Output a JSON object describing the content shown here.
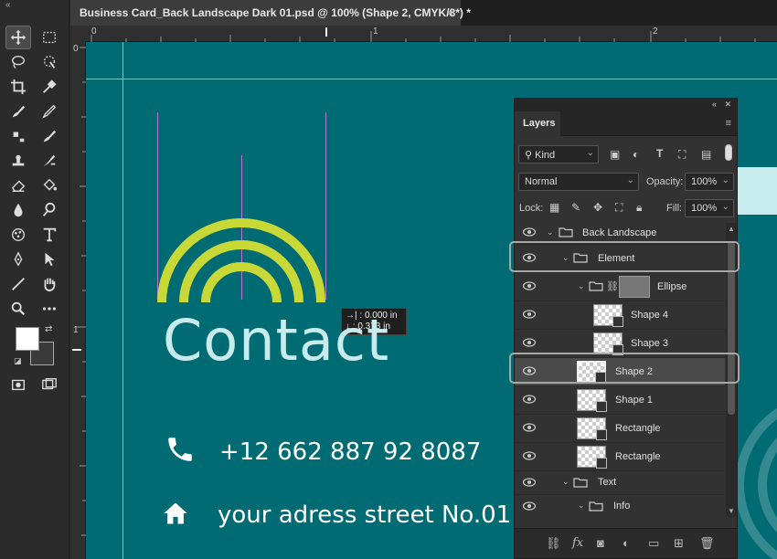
{
  "document": {
    "tab_title": "Business Card_Back Landscape Dark 01.psd @ 100% (Shape 2, CMYK/8*) *",
    "close_glyph": "×"
  },
  "toolbar": {
    "collapse_glyph": "«",
    "tools": [
      "move-tool",
      "marquee-tool",
      "lasso-tool",
      "object-selection-tool",
      "crop-tool",
      "eyedropper-tool",
      "healing-brush-tool",
      "brush-tool",
      "clone-stamp-tool",
      "history-brush-tool",
      "eraser-tool",
      "gradient-tool",
      "blur-tool",
      "dodge-tool",
      "pen-tool",
      "type-tool",
      "path-selection-tool",
      "rectangle-tool",
      "hand-tool",
      "zoom-tool",
      "more-tools",
      "quick-mask",
      "screen-mode"
    ],
    "foreground_color": "#ffffff",
    "background_color": "#3a3a3a"
  },
  "rulers": {
    "top_marks": [
      "0",
      "1",
      "2"
    ],
    "left_marks": [
      "0",
      "1"
    ]
  },
  "canvas": {
    "background_color": "#006b72",
    "arc_color": "#c8d937",
    "title": "Contact",
    "phone": "+12 662 887 92 8087",
    "address": "your adress street No.01",
    "tooltip_x": "0.000 in",
    "tooltip_y": "0.373 in"
  },
  "layers_panel": {
    "tab_label": "Layers",
    "filter_kind": "Kind",
    "blend_mode": "Normal",
    "opacity_label": "Opacity:",
    "opacity_value": "100%",
    "lock_label": "Lock:",
    "fill_label": "Fill:",
    "fill_value": "100%",
    "layers": [
      {
        "name": "Back Landscape",
        "type": "group",
        "indent": 0,
        "expanded": true
      },
      {
        "name": "Element",
        "type": "group",
        "indent": 1,
        "expanded": true,
        "highlighted": true
      },
      {
        "name": "Ellipse",
        "type": "group-masked",
        "indent": 2,
        "expanded": true
      },
      {
        "name": "Shape 4",
        "type": "shape",
        "indent": 3
      },
      {
        "name": "Shape 3",
        "type": "shape",
        "indent": 3
      },
      {
        "name": "Shape 2",
        "type": "shape",
        "indent": 2,
        "selected": true,
        "highlighted": true
      },
      {
        "name": "Shape 1",
        "type": "shape",
        "indent": 2
      },
      {
        "name": "Rectangle",
        "type": "shape",
        "indent": 2
      },
      {
        "name": "Rectangle",
        "type": "shape",
        "indent": 2
      },
      {
        "name": "Text",
        "type": "group",
        "indent": 1,
        "expanded": true
      },
      {
        "name": "Info",
        "type": "group",
        "indent": 2,
        "expanded": true
      }
    ],
    "footer_icons": [
      "link-layers-icon",
      "fx-icon",
      "add-mask-icon",
      "adjustment-layer-icon",
      "new-group-icon",
      "new-layer-icon",
      "delete-layer-icon"
    ]
  }
}
